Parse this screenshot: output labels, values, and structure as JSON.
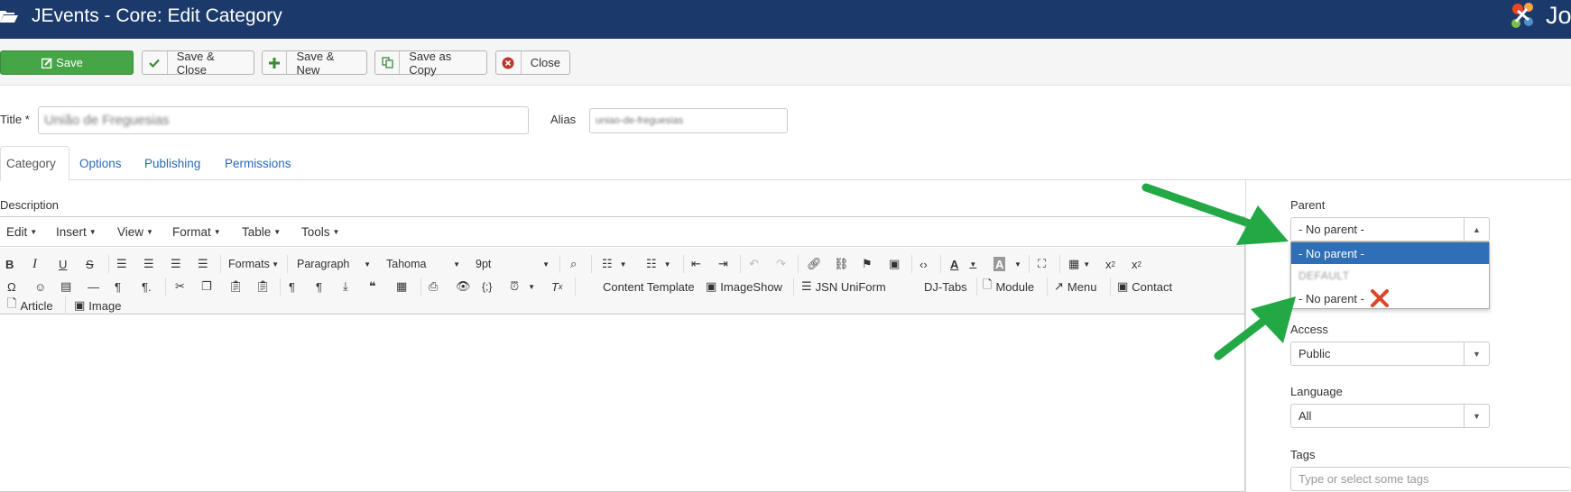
{
  "header": {
    "title": "JEvents - Core: Edit Category",
    "logo_text": "Jo"
  },
  "toolbar": {
    "save": "Save",
    "save_close": "Save & Close",
    "save_new": "Save & New",
    "save_copy": "Save as Copy",
    "close": "Close"
  },
  "form": {
    "title_label": "Title *",
    "title_value": "União de Freguesias",
    "alias_label": "Alias",
    "alias_value": "uniao-de-freguesias"
  },
  "tabs": [
    "Category",
    "Options",
    "Publishing",
    "Permissions"
  ],
  "editor": {
    "description_label": "Description",
    "menus": [
      "Edit",
      "Insert",
      "View",
      "Format",
      "Table",
      "Tools"
    ],
    "formats": "Formats",
    "block": "Paragraph",
    "font": "Tahoma",
    "size": "9pt",
    "plugins": [
      "Content Template",
      "ImageShow",
      "JSN UniForm",
      "DJ-Tabs",
      "Module",
      "Menu",
      "Contact"
    ],
    "row3": [
      "Article",
      "Image"
    ]
  },
  "sidebar": {
    "parent_label": "Parent",
    "parent_value": "- No parent -",
    "parent_options": [
      "- No parent -",
      "DEFAULT",
      "- No parent -"
    ],
    "access_label": "Access",
    "access_value": "Public",
    "language_label": "Language",
    "language_value": "All",
    "tags_label": "Tags",
    "tags_placeholder": "Type or select some tags"
  },
  "colors": {
    "header": "#1b3a6b",
    "save": "#46a546",
    "highlight": "#2f6fb7",
    "arrow": "#22a845",
    "cross": "#d9472b"
  }
}
